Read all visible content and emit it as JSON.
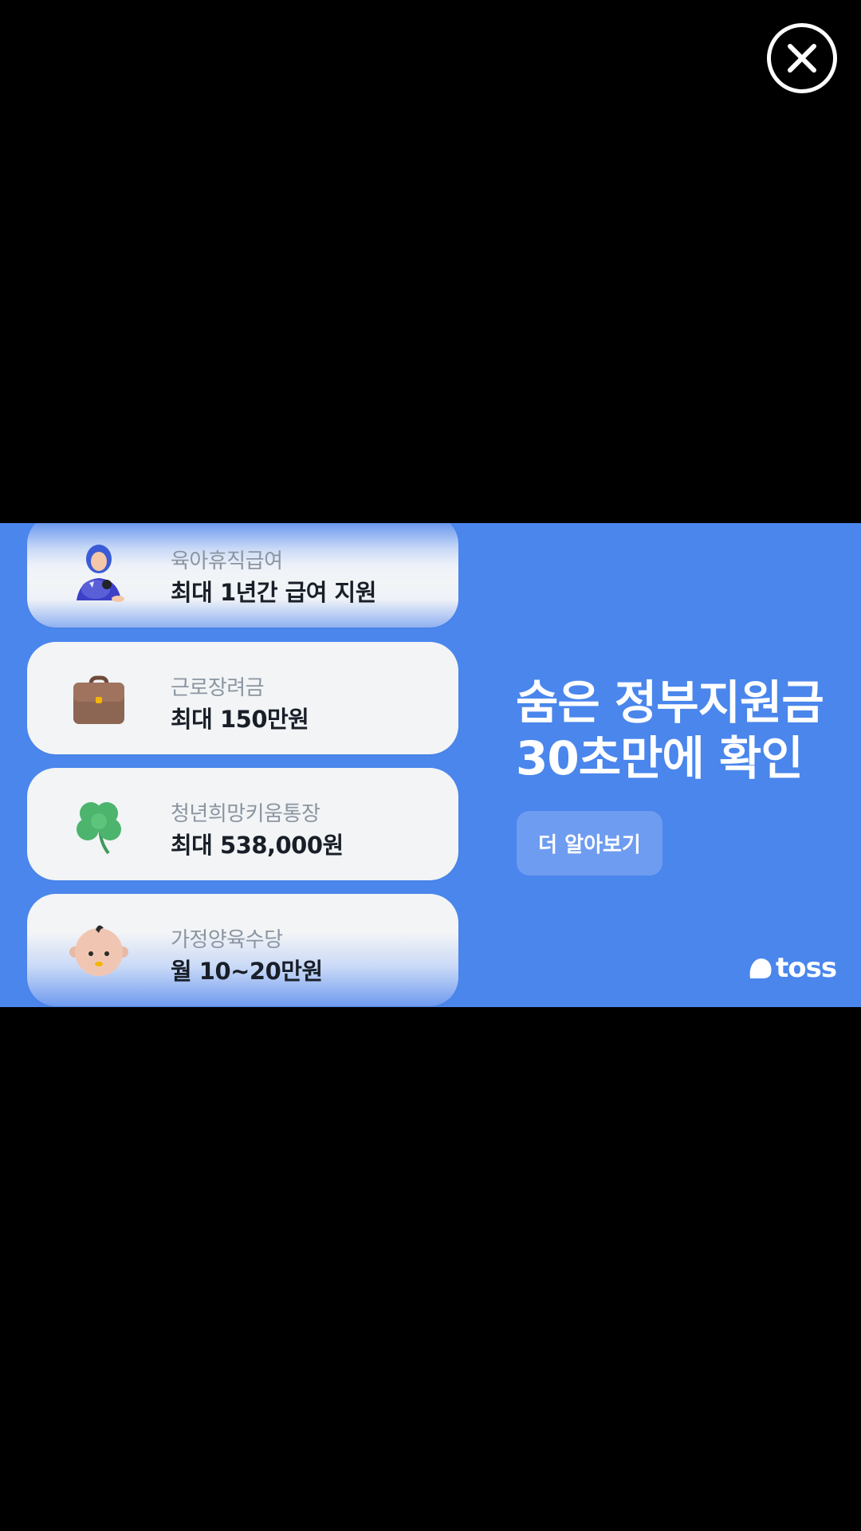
{
  "close": {
    "icon": "close-icon"
  },
  "ad": {
    "background_color": "#4a86ec",
    "cards": [
      {
        "label": "육아휴직급여",
        "value": "최대 1년간 급여 지원",
        "icon": "parent-with-baby-icon"
      },
      {
        "label": "근로장려금",
        "value": "최대 150만원",
        "icon": "briefcase-icon"
      },
      {
        "label": "청년희망키움통장",
        "value": "최대 538,000원",
        "icon": "clover-icon"
      },
      {
        "label": "가정양육수당",
        "value": "월 10~20만원",
        "icon": "baby-face-icon"
      }
    ],
    "headline": {
      "line1": "숨은 정부지원금",
      "line2": "30초만에 확인"
    },
    "cta_label": "더 알아보기",
    "brand": {
      "name": "toss",
      "icon": "toss-logo-icon"
    }
  }
}
